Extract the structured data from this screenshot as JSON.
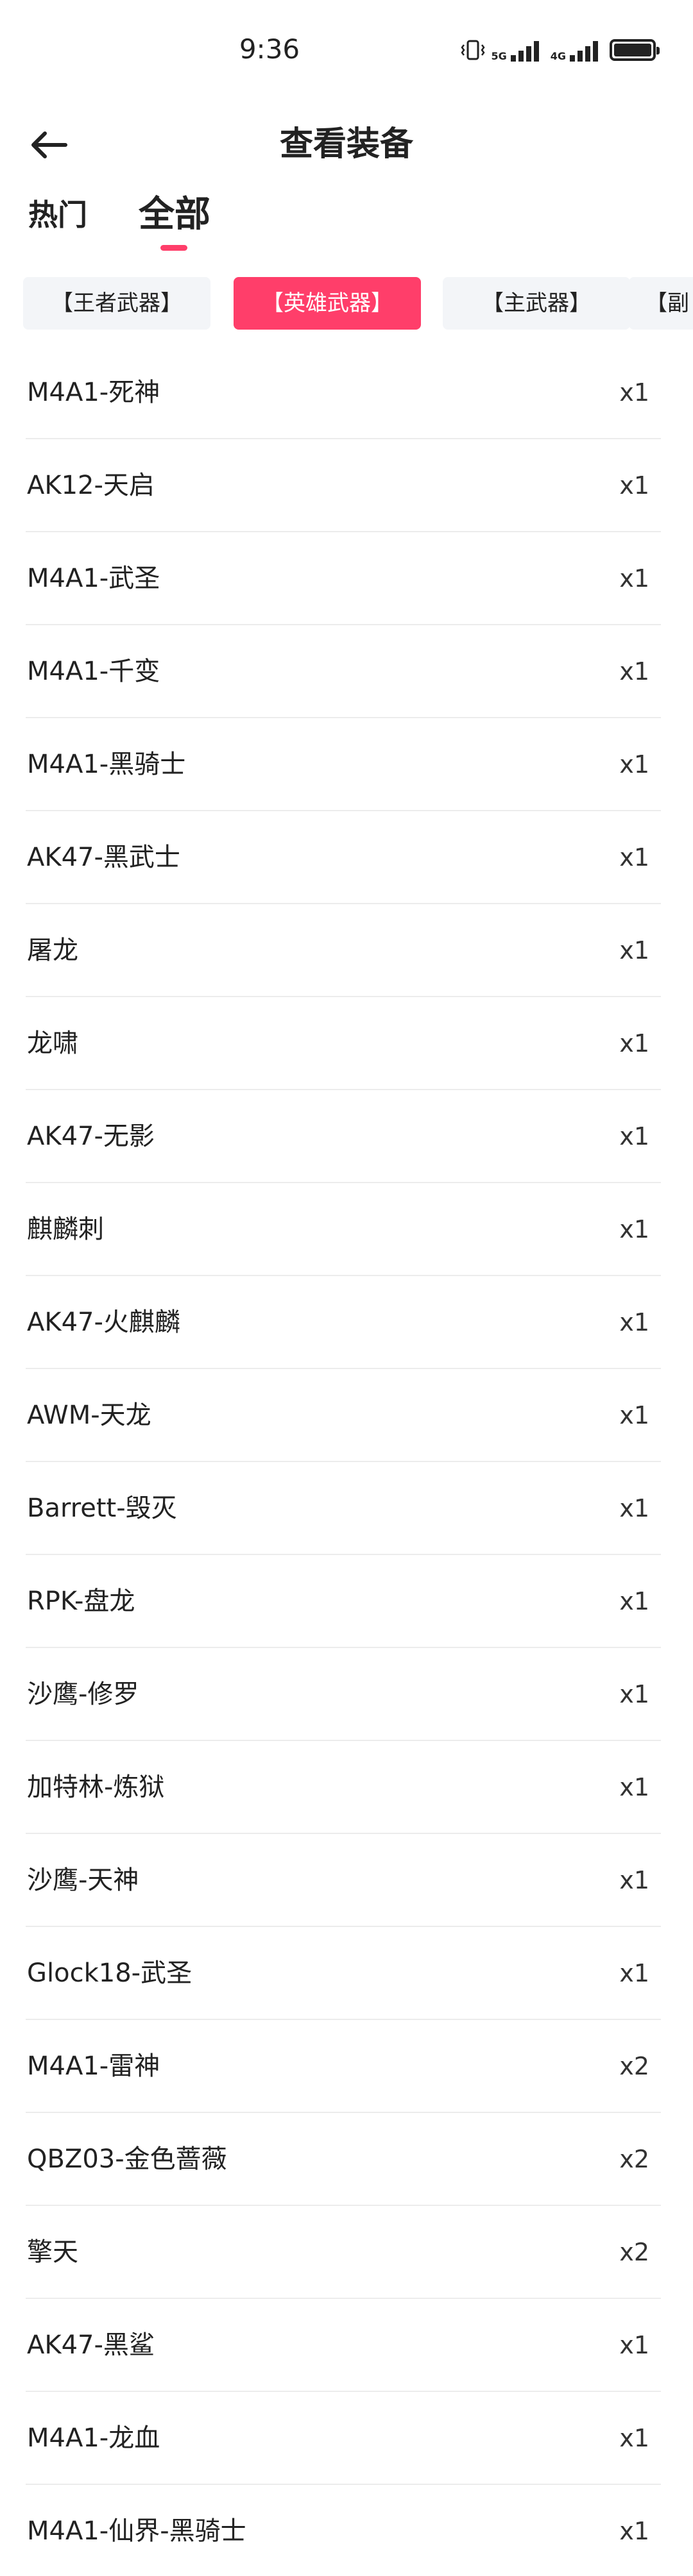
{
  "status_bar": {
    "time": "9:36",
    "network_1": "5G",
    "network_2": "4G",
    "icons": [
      "vibrate-icon",
      "signal-5g-icon",
      "signal-4g-icon",
      "battery-icon"
    ]
  },
  "header": {
    "back_icon": "arrow-left-icon",
    "title": "查看装备"
  },
  "tabs": [
    {
      "label": "热门",
      "selected": false
    },
    {
      "label": "全部",
      "selected": true
    }
  ],
  "accent_color": "#ff3e6a",
  "categories": [
    {
      "label": "【王者武器】",
      "selected": false
    },
    {
      "label": "【英雄武器】",
      "selected": true
    },
    {
      "label": "【主武器】",
      "selected": false
    },
    {
      "label": "【副",
      "selected": false
    }
  ],
  "items": [
    {
      "name": "M4A1-死神",
      "qty": "x1"
    },
    {
      "name": "AK12-天启",
      "qty": "x1"
    },
    {
      "name": "M4A1-武圣",
      "qty": "x1"
    },
    {
      "name": "M4A1-千变",
      "qty": "x1"
    },
    {
      "name": "M4A1-黑骑士",
      "qty": "x1"
    },
    {
      "name": "AK47-黑武士",
      "qty": "x1"
    },
    {
      "name": "屠龙",
      "qty": "x1"
    },
    {
      "name": "龙啸",
      "qty": "x1"
    },
    {
      "name": "AK47-无影",
      "qty": "x1"
    },
    {
      "name": "麒麟刺",
      "qty": "x1"
    },
    {
      "name": "AK47-火麒麟",
      "qty": "x1"
    },
    {
      "name": "AWM-天龙",
      "qty": "x1"
    },
    {
      "name": "Barrett-毁灭",
      "qty": "x1"
    },
    {
      "name": "RPK-盘龙",
      "qty": "x1"
    },
    {
      "name": "沙鹰-修罗",
      "qty": "x1"
    },
    {
      "name": "加特林-炼狱",
      "qty": "x1"
    },
    {
      "name": "沙鹰-天神",
      "qty": "x1"
    },
    {
      "name": "Glock18-武圣",
      "qty": "x1"
    },
    {
      "name": "M4A1-雷神",
      "qty": "x2"
    },
    {
      "name": "QBZ03-金色蔷薇",
      "qty": "x2"
    },
    {
      "name": "擎天",
      "qty": "x2"
    },
    {
      "name": "AK47-黑鲨",
      "qty": "x1"
    },
    {
      "name": "M4A1-龙血",
      "qty": "x1"
    },
    {
      "name": "M4A1-仙界-黑骑士",
      "qty": "x1"
    }
  ]
}
